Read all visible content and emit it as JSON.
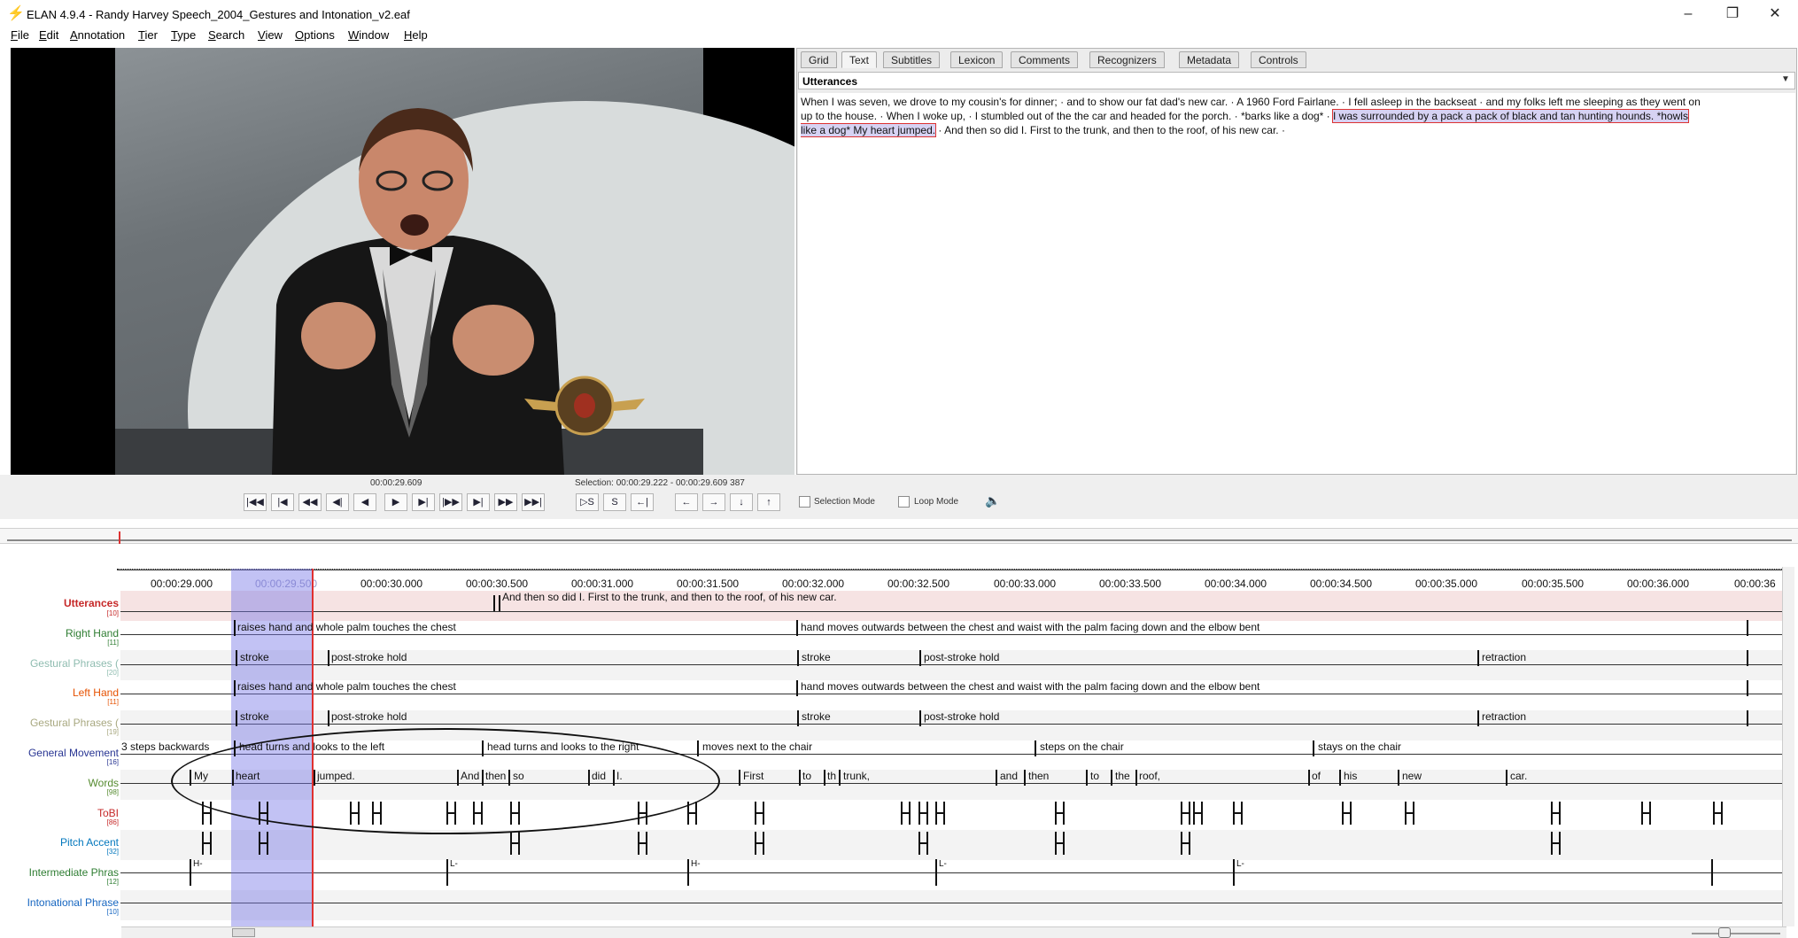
{
  "window": {
    "title": "ELAN 4.9.4 - Randy Harvey Speech_2004_Gestures and Intonation_v2.eaf",
    "app_icon": "elan-icon"
  },
  "menu": [
    "File",
    "Edit",
    "Annotation",
    "Tier",
    "Type",
    "Search",
    "View",
    "Options",
    "Window",
    "Help"
  ],
  "tabs": [
    "Grid",
    "Text",
    "Subtitles",
    "Lexicon",
    "Comments",
    "Recognizers",
    "Metadata",
    "Controls"
  ],
  "active_tab": "Text",
  "text_panel": {
    "tier": "Utterances",
    "line1": "When I was seven, we drove to my cousin's for dinner;  ·  and to show our fat dad's new car.  ·  A 1960 Ford Fairlane.  ·  I fell asleep in the backseat  ·  and my folks left me sleeping as they went on",
    "line2_pre": "up to the house.  ·  When I woke up,  ·  I stumbled out of the the car and headed for the porch.  ·  *barks like a dog*  ·  ",
    "line2_hl": "I was surrounded by a pack a pack of black and tan hunting hounds. *howls",
    "line3_hl": "like a dog* My heart jumped.",
    "line3_post": "  ·  And then so did I. First to the trunk, and then to the roof, of his new car.  ·"
  },
  "controls": {
    "current_time": "00:00:29.609",
    "selection": "Selection: 00:00:29.222 - 00:00:29.609  387",
    "buttons": [
      "|◀◀",
      "|◀",
      "◀◀",
      "◀|",
      "◀",
      "▶",
      "▶|",
      "|▶▶",
      "▶|",
      "▶▶",
      "▶▶|"
    ],
    "sel_buttons": [
      "▷S",
      "S",
      "←|"
    ],
    "nav_buttons": [
      "←",
      "→",
      "↓",
      "↑"
    ],
    "selection_mode": "Selection Mode",
    "loop_mode": "Loop Mode"
  },
  "ruler": [
    "00:00:29.000",
    "00:00:29.500",
    "00:00:30.000",
    "00:00:30.500",
    "00:00:31.000",
    "00:00:31.500",
    "00:00:32.000",
    "00:00:32.500",
    "00:00:33.000",
    "00:00:33.500",
    "00:00:34.000",
    "00:00:34.500",
    "00:00:35.000",
    "00:00:35.500",
    "00:00:36.000",
    "00:00:36"
  ],
  "tiers": [
    {
      "name": "Utterances",
      "count": "[10]",
      "color": "#c62828"
    },
    {
      "name": "Right Hand",
      "count": "[11]",
      "color": "#2e7d32"
    },
    {
      "name": "Gestural Phrases (",
      "count": "[20]",
      "color": "#8fbcb0"
    },
    {
      "name": "Left Hand",
      "count": "[11]",
      "color": "#e65100"
    },
    {
      "name": "Gestural Phrases (",
      "count": "[19]",
      "color": "#a8a880"
    },
    {
      "name": "General Movement",
      "count": "[16]",
      "color": "#283593"
    },
    {
      "name": "Words",
      "count": "[98]",
      "color": "#558b2f"
    },
    {
      "name": "ToBI",
      "count": "[86]",
      "color": "#c62828"
    },
    {
      "name": "Pitch Accent",
      "count": "[32]",
      "color": "#0277bd"
    },
    {
      "name": "Intermediate Phras",
      "count": "[12]",
      "color": "#2e7d32"
    },
    {
      "name": "Intonational Phrase",
      "count": "[10]",
      "color": "#1565c0"
    }
  ],
  "annotations": {
    "utterances": [
      "And then so did I. First to the trunk, and then to the roof, of his new car."
    ],
    "right_hand": [
      "raises hand and whole palm touches the chest",
      "hand moves outwards between the chest and waist with the palm facing down and the elbow bent"
    ],
    "gestural_rh": [
      "stroke",
      "post-stroke hold",
      "stroke",
      "post-stroke hold",
      "retraction"
    ],
    "left_hand": [
      "raises hand and whole palm touches the chest",
      "hand moves outwards between the chest and waist with the palm facing down and the elbow bent"
    ],
    "gestural_lh": [
      "stroke",
      "post-stroke hold",
      "stroke",
      "post-stroke hold",
      "retraction"
    ],
    "general": [
      "3 steps backwards",
      "head turns and looks to the left",
      "head turns and looks to the right",
      "moves next to the chair",
      "steps on the chair",
      "stays on the chair"
    ],
    "words": [
      "My",
      "heart",
      "jumped.",
      "And",
      "then",
      "so",
      "did",
      "I.",
      "First",
      "to",
      "th",
      "trunk,",
      "and",
      "then",
      "to",
      "the",
      "roof,",
      "of",
      "his",
      "new",
      "car."
    ],
    "intermediate": [
      "H-",
      "L-",
      "H-",
      "L-",
      "L-"
    ]
  }
}
